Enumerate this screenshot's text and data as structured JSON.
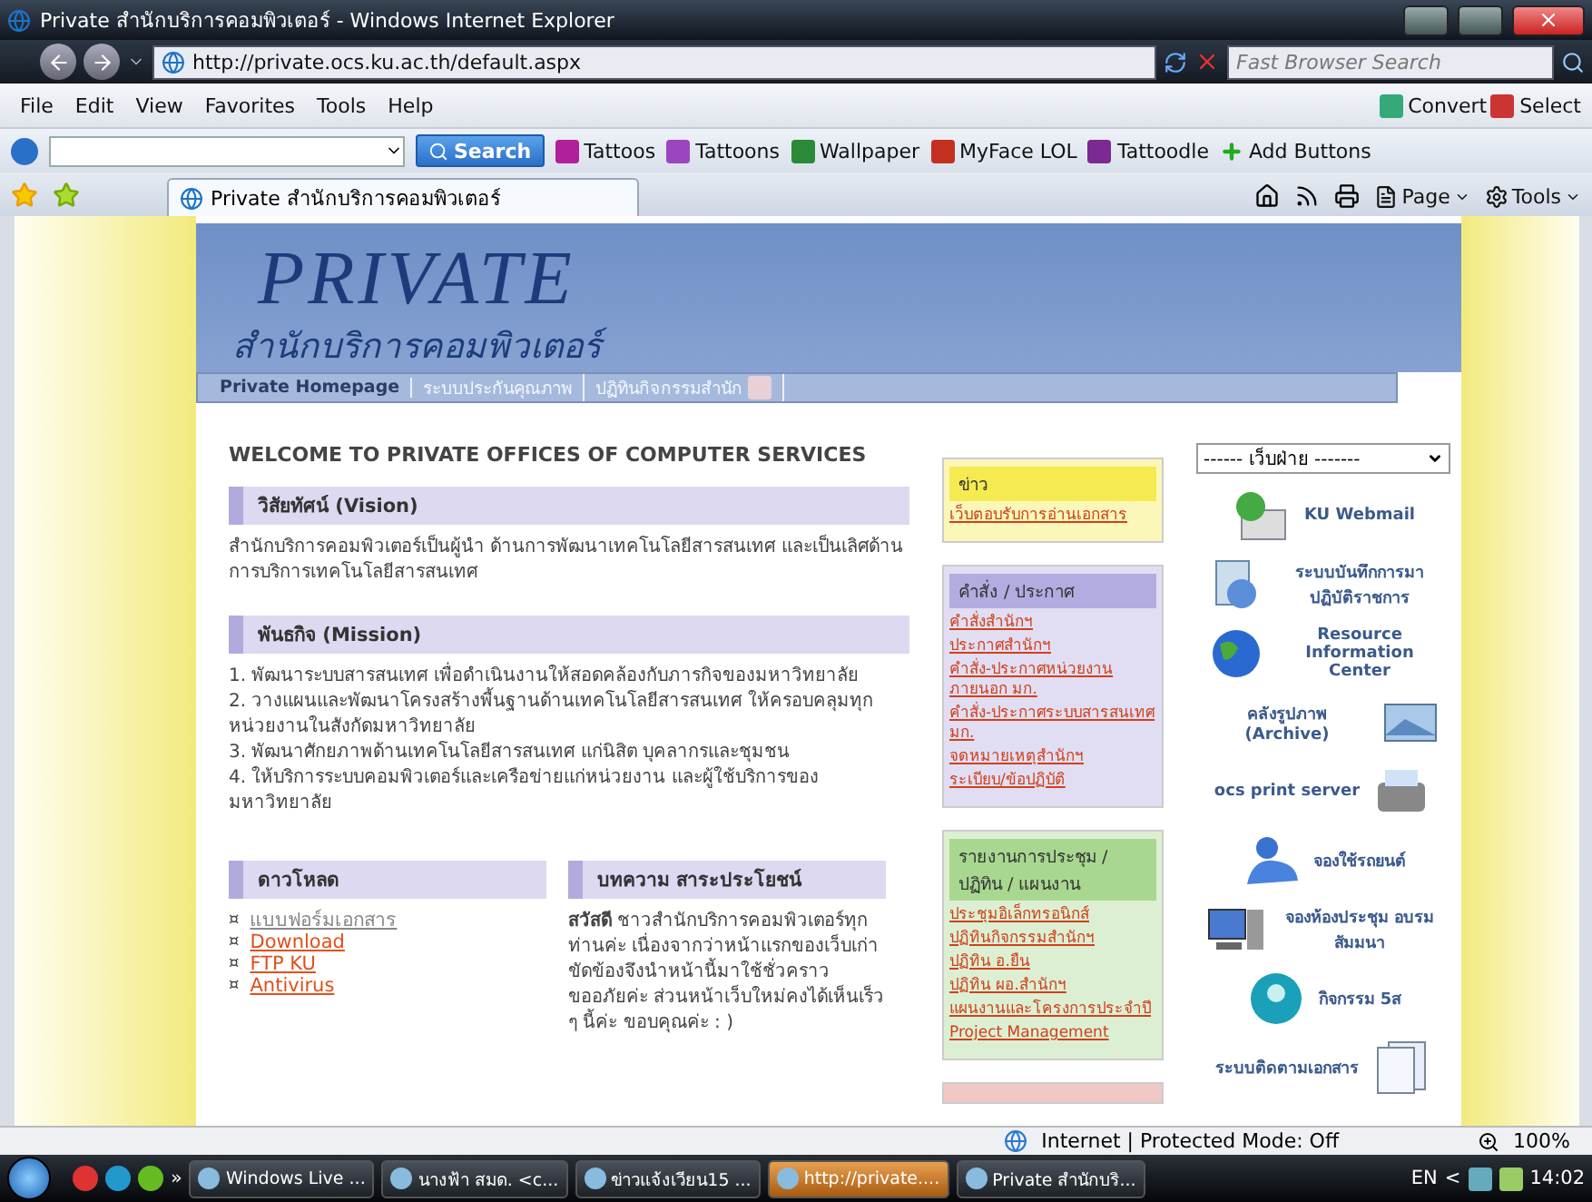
{
  "window": {
    "title": "Private สำนักบริการคอมพิวเตอร์ - Windows Internet Explorer"
  },
  "address_bar": {
    "url": "http://private.ocs.ku.ac.th/default.aspx"
  },
  "search_box": {
    "placeholder": "Fast Browser Search"
  },
  "menu": [
    "File",
    "Edit",
    "View",
    "Favorites",
    "Tools",
    "Help"
  ],
  "menu_right": [
    "Convert",
    "Select"
  ],
  "links_toolbar": {
    "search_button": "Search",
    "links": [
      "Tattoos",
      "Tattoons",
      "Wallpaper",
      "MyFace LOL",
      "Tattoodle"
    ],
    "add_buttons": "Add Buttons"
  },
  "tabs": [
    {
      "label": "Private สำนักบริการคอมพิวเตอร์",
      "selected": true
    }
  ],
  "command_bar": [
    "Page",
    "Tools"
  ],
  "header": {
    "title": "PRIVATE",
    "subtitle": "สำนักบริการคอมพิวเตอร์"
  },
  "nav": [
    {
      "label": "Private Homepage",
      "selected": true
    },
    {
      "label": "ระบบประกันคุณภาพ",
      "selected": false
    },
    {
      "label": "ปฏิทินกิจกรรมสำนัก",
      "selected": false
    }
  ],
  "welcome": "WELCOME TO PRIVATE OFFICES OF COMPUTER SERVICES",
  "sections": [
    {
      "heading": "วิสัยทัศน์ (Vision)",
      "lines": [
        "สำนักบริการคอมพิวเตอร์เป็นผู้นำ ด้านการพัฒนาเทคโนโลยีสารสนเทศ และเป็นเลิศด้านการบริการเทคโนโลยีสารสนเทศ"
      ]
    },
    {
      "heading": "พันธกิจ (Mission)",
      "lines": [
        "1. พัฒนาระบบสารสนเทศ เพื่อดำเนินงานให้สอดคล้องกับภารกิจของมหาวิทยาลัย",
        "2. วางแผนและพัฒนาโครงสร้างพื้นฐานด้านเทคโนโลยีสารสนเทศ ให้ครอบคลุมทุกหน่วยงานในสังกัดมหาวิทยาลัย",
        "3. พัฒนาศักยภาพด้านเทคโนโลยีสารสนเทศ แก่นิสิต บุคลากรและชุมชน",
        "4. ให้บริการระบบคอมพิวเตอร์และเครือข่ายแก่หน่วยงาน และผู้ใช้บริการของมหาวิทยาลัย"
      ]
    }
  ],
  "downloads": {
    "heading": "ดาวโหลด",
    "bullet": "¤",
    "links": [
      {
        "label": "แบบฟอร์มเอกสาร",
        "visited": true
      },
      {
        "label": "Download",
        "visited": false
      },
      {
        "label": "FTP KU",
        "visited": false
      },
      {
        "label": "Antivirus",
        "visited": false
      }
    ]
  },
  "articles": {
    "heading": "บทความ สาระประโยชน์",
    "lead": "สวัสดี",
    "text": "ชาวสำนักบริการคอมพิวเตอร์ทุกท่านค่ะ เนื่องจากว่าหน้าแรกของเว็บเก่าขัดข้องจึงนำหน้านี้มาใช้ชั่วคราว ขออภัยค่ะ ส่วนหน้าเว็บใหม่คงได้เห็นเร็ว ๆ นี้ค่ะ ขอบคุณค่ะ : )"
  },
  "boxes": [
    {
      "title": "ข่าว",
      "color": "#f5ea50",
      "links": [
        "เว็บตอบรับการอ่านเอกสาร"
      ]
    },
    {
      "title": "คำสั่ง / ประกาศ",
      "color": "#b3ace0",
      "links": [
        "คำสั่งสำนักฯ",
        "ประกาศสำนักฯ",
        "คำสั่ง-ประกาศหน่วยงานภายนอก มก.",
        "คำสั่ง-ประกาศระบบสารสนเทศ มก.",
        "จดหมายเหตุสำนักฯ",
        "ระเบียบ/ข้อปฏิบัติ"
      ]
    },
    {
      "title": "รายงานการประชุม / ปฏิทิน / แผนงาน",
      "color": "#a8d890",
      "links": [
        "ประชุมอิเล็กทรอนิกส์",
        "ปฏิทินกิจกรรมสำนักฯ",
        "ปฏิทิน อ.ยืน",
        "ปฏิทิน ผอ.สำนักฯ",
        "แผนงานและโครงการประจำปี",
        "Project Management"
      ]
    },
    {
      "color": "#f0c8c8"
    }
  ],
  "departments_select": {
    "value": "------ เว็บฝ่าย -------"
  },
  "services": [
    {
      "label": "KU Webmail",
      "kind": "icon-left"
    },
    {
      "label": "ระบบบันทึกการมาปฏิบัติราชการ",
      "kind": "icon-left"
    },
    {
      "label": "Resource Information Center",
      "kind": "icon-left"
    },
    {
      "label": "คลังรูปภาพ (Archive)",
      "kind": "icon-right"
    },
    {
      "label": "ocs print server",
      "kind": "icon-right"
    },
    {
      "label": "จองใช้รถยนต์",
      "kind": "icon-left"
    },
    {
      "label": "จองห้องประชุม อบรม สัมมนา",
      "kind": "icon-left"
    },
    {
      "label": "กิจกรรม 5ส",
      "kind": "icon-left"
    },
    {
      "label": "ระบบติดตามเอกสาร",
      "kind": "icon-right"
    }
  ],
  "status_bar": {
    "zone": "Internet | Protected Mode: Off",
    "zoom": "100%"
  },
  "taskbar": {
    "overflow": "»",
    "buttons": [
      {
        "label": "Windows Live ...",
        "highlighted": false
      },
      {
        "label": "นางฟ้า สมด. <c...",
        "highlighted": false
      },
      {
        "label": "ข่าวแจ้งเวียน15 ...",
        "highlighted": false
      },
      {
        "label": "http://private....",
        "highlighted": true
      },
      {
        "label": "Private สำนักบริ...",
        "highlighted": false
      }
    ],
    "language": "EN",
    "tray_arrow": "<",
    "clock": "14:02"
  }
}
